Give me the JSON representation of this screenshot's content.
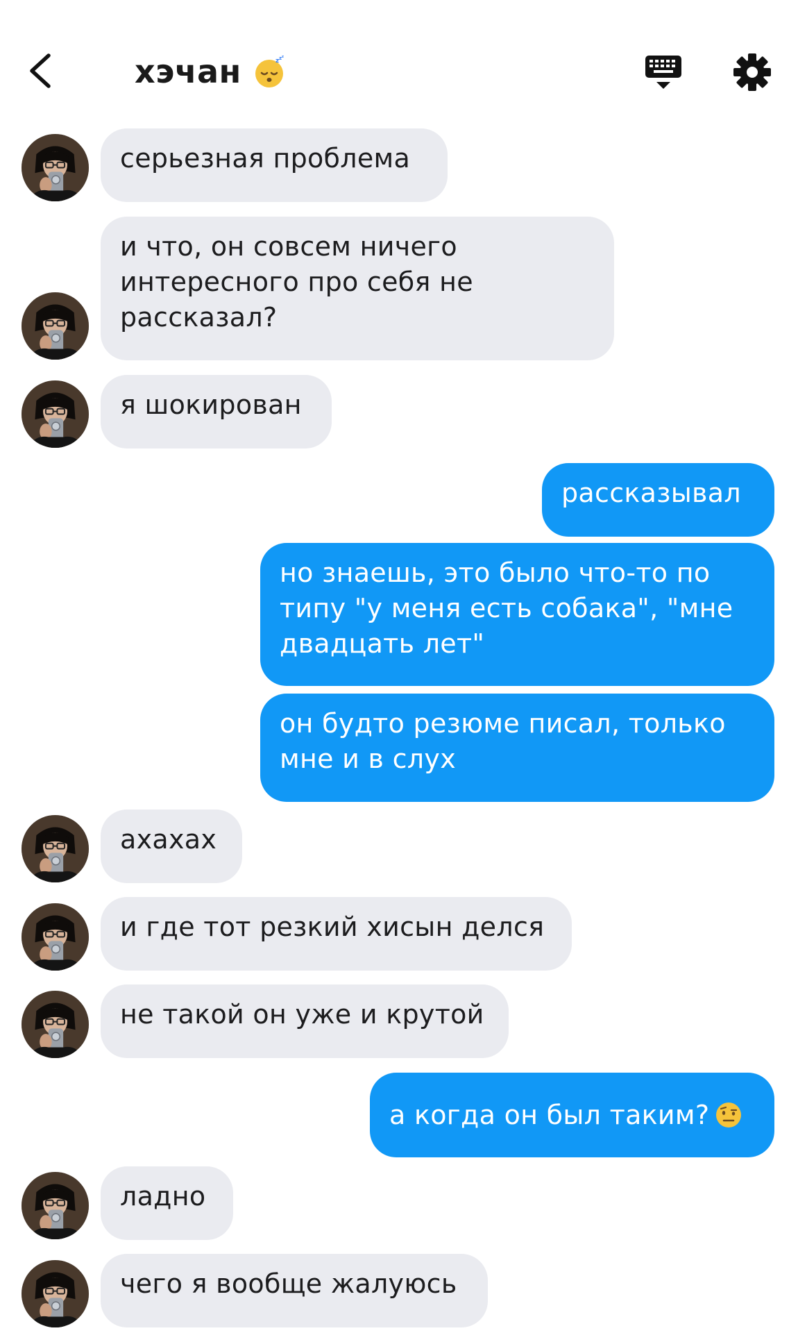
{
  "header": {
    "title": "хэчан",
    "title_emoji": "sleeping-face-icon",
    "back_icon": "chevron-left-icon",
    "keyboard_icon": "keyboard-icon",
    "settings_icon": "gear-icon"
  },
  "colors": {
    "incoming_bubble": "#eaebf0",
    "outgoing_bubble": "#1198f6",
    "outgoing_text": "#ffffff",
    "incoming_text": "#1c1c1e"
  },
  "messages": [
    {
      "from": "them",
      "line1": "серьезная проблема"
    },
    {
      "from": "them",
      "line1": "и что, он совсем ничего",
      "line2": "интересного про себя не",
      "line3": "рассказал?"
    },
    {
      "from": "them",
      "line1": "я шокирован"
    },
    {
      "from": "me",
      "line1": "рассказывал"
    },
    {
      "from": "me",
      "line1": "но знаешь, это было что-то по",
      "line2": "типу \"у меня есть собака\", \"мне",
      "line3": "двадцать лет\""
    },
    {
      "from": "me",
      "line1": "он будто резюме писал, только",
      "line2": "мне и в слух"
    },
    {
      "from": "them",
      "line1": "ахахах"
    },
    {
      "from": "them",
      "line1": "и где тот резкий хисын делся"
    },
    {
      "from": "them",
      "line1": "не такой он уже и крутой"
    },
    {
      "from": "me",
      "line1": "а когда он был таким?",
      "emoji": "raised-eyebrow-face-icon"
    },
    {
      "from": "them",
      "line1": "ладно"
    },
    {
      "from": "them",
      "line1": "чего я вообще жалуюсь"
    }
  ]
}
